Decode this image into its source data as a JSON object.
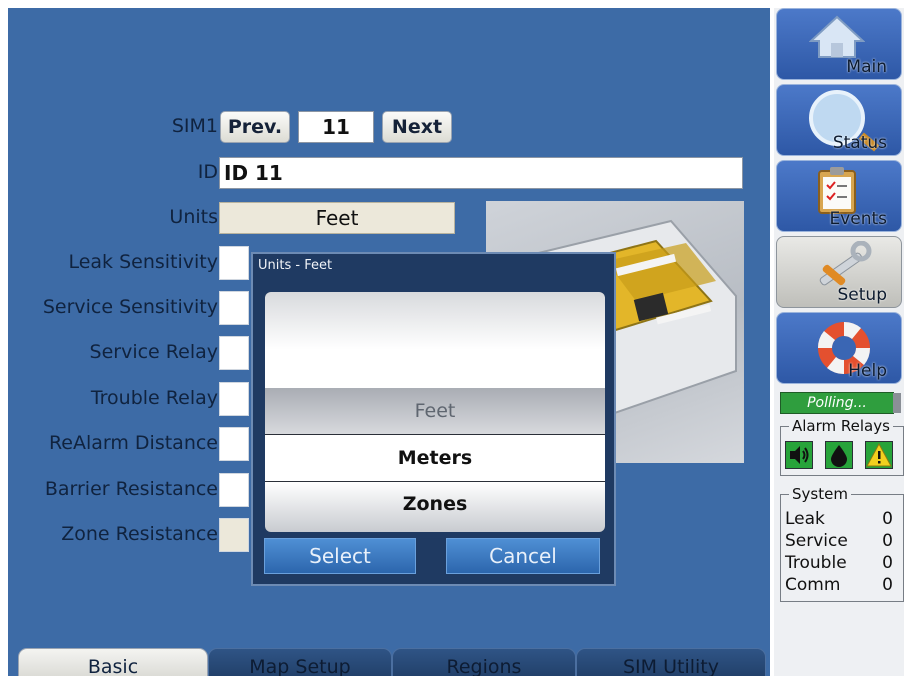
{
  "form": {
    "sim_label": "SIM1",
    "prev_label": "Prev.",
    "sim_number": "11",
    "next_label": "Next",
    "id_label": "ID",
    "id_value": "ID 11",
    "units_label": "Units",
    "units_value": "Feet",
    "leak_sensitivity_label": "Leak Sensitivity",
    "service_sensitivity_label": "Service Sensitivity",
    "service_relay_label": "Service Relay",
    "trouble_relay_label": "Trouble Relay",
    "realarm_distance_label": "ReAlarm Distance",
    "barrier_resistance_label": "Barrier Resistance",
    "zone_resistance_label": "Zone Resistance"
  },
  "dialog": {
    "title": "Units - Feet",
    "options": [
      "Feet",
      "Meters",
      "Zones"
    ],
    "selected": "Feet",
    "select_label": "Select",
    "cancel_label": "Cancel"
  },
  "tabs": [
    {
      "label": "Basic",
      "active": true
    },
    {
      "label": "Map Setup",
      "active": false
    },
    {
      "label": "Regions",
      "active": false
    },
    {
      "label": "SIM Utility",
      "active": false
    }
  ],
  "nav": {
    "main": {
      "label": "Main",
      "icon": "house-icon"
    },
    "status": {
      "label": "Status",
      "icon": "magnifier-icon"
    },
    "events": {
      "label": "Events",
      "icon": "clipboard-icon"
    },
    "setup": {
      "label": "Setup",
      "icon": "tools-icon",
      "active": true
    },
    "help": {
      "label": "Help",
      "icon": "lifebuoy-icon"
    }
  },
  "polling_text": "Polling...",
  "alarm_relays": {
    "title": "Alarm Relays",
    "icons": [
      "speaker-icon",
      "water-drop-icon",
      "warning-icon"
    ]
  },
  "system": {
    "title": "System",
    "rows": [
      {
        "label": "Leak",
        "value": "0"
      },
      {
        "label": "Service",
        "value": "0"
      },
      {
        "label": "Trouble",
        "value": "0"
      },
      {
        "label": "Comm",
        "value": "0"
      }
    ]
  },
  "colors": {
    "panel_blue": "#3d6ba6",
    "dialog_navy": "#1f3a62",
    "button_blue": "#3a78c2",
    "polling_green": "#2f9e3e",
    "relay_green": "#27a33a",
    "warning_yellow": "#f2d01e"
  }
}
